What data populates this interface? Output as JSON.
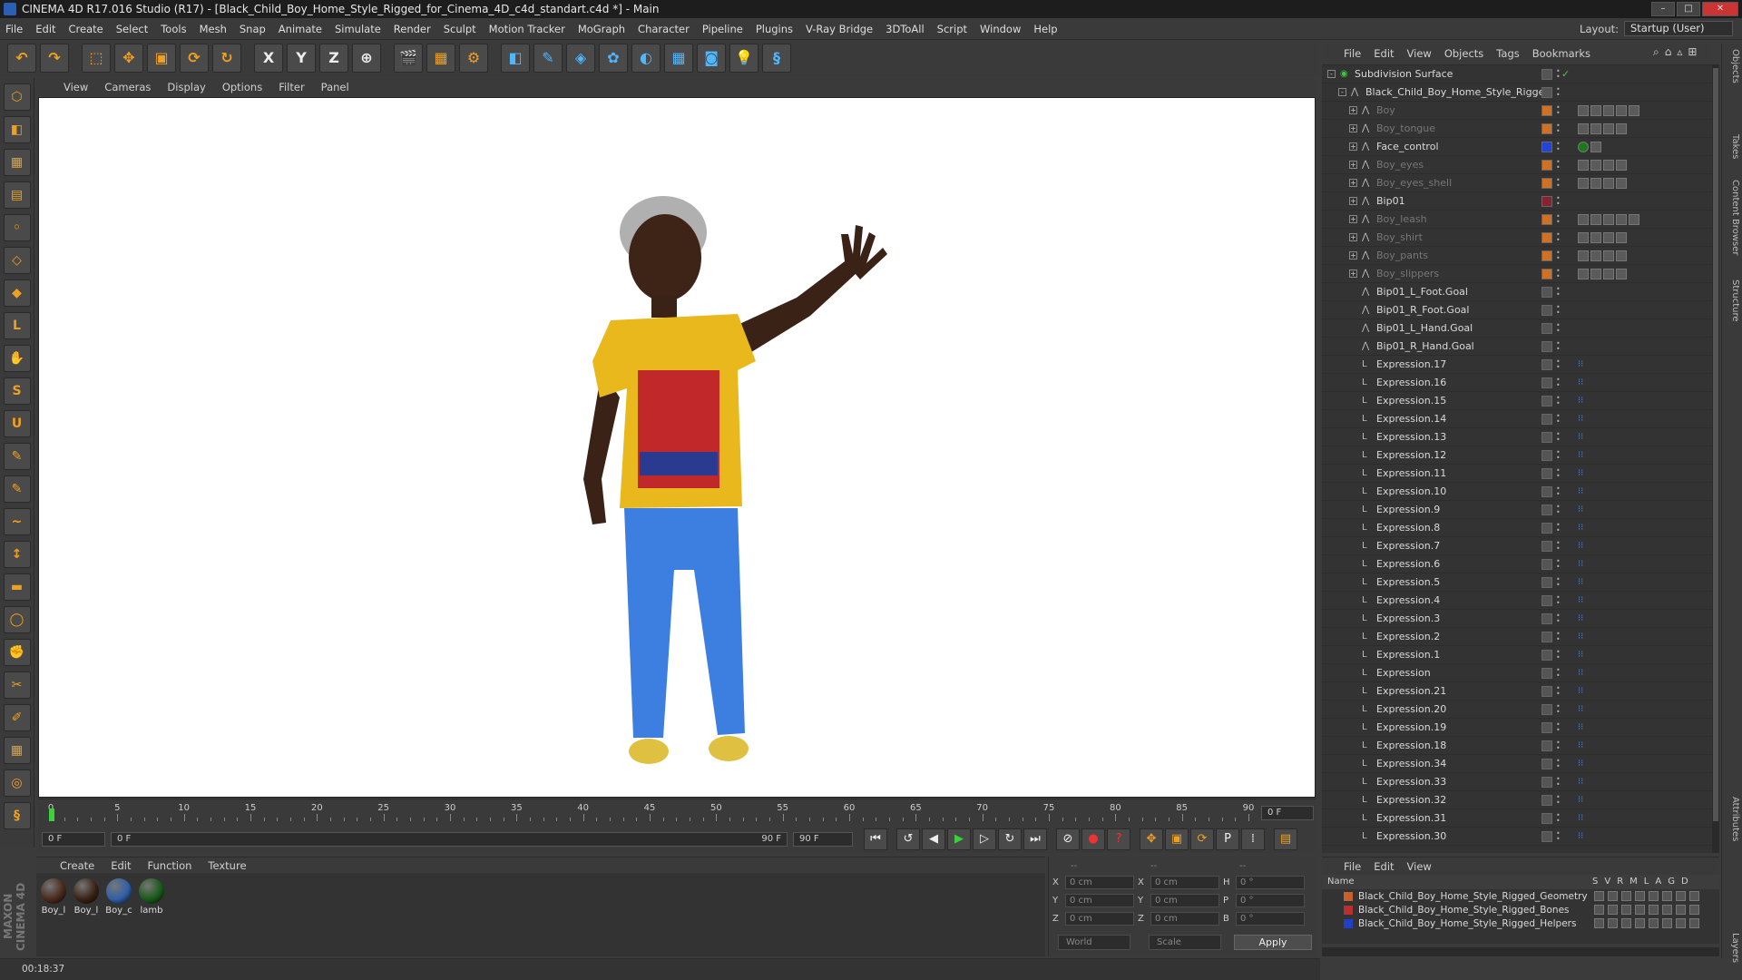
{
  "window": {
    "title": "CINEMA 4D R17.016 Studio (R17) - [Black_Child_Boy_Home_Style_Rigged_for_Cinema_4D_c4d_standart.c4d *] - Main"
  },
  "menubar": [
    "File",
    "Edit",
    "Create",
    "Select",
    "Tools",
    "Mesh",
    "Snap",
    "Animate",
    "Simulate",
    "Render",
    "Sculpt",
    "Motion Tracker",
    "MoGraph",
    "Character",
    "Pipeline",
    "Plugins",
    "V-Ray Bridge",
    "3DToAll",
    "Script",
    "Window",
    "Help"
  ],
  "layout": {
    "label": "Layout:",
    "value": "Startup (User)"
  },
  "viewport_menu": [
    "View",
    "Cameras",
    "Display",
    "Options",
    "Filter",
    "Panel"
  ],
  "timeline": {
    "ticks": [
      "0",
      "5",
      "10",
      "15",
      "20",
      "25",
      "30",
      "35",
      "40",
      "45",
      "50",
      "55",
      "60",
      "65",
      "70",
      "75",
      "80",
      "85",
      "90"
    ],
    "current_field": "0 F",
    "start_field": "0 F",
    "range_start": "0 F",
    "range_end": "90 F",
    "end_field": "90 F"
  },
  "material_menu": [
    "Create",
    "Edit",
    "Function",
    "Texture"
  ],
  "materials": [
    {
      "label": "Boy_l",
      "color": "#4a2a1c"
    },
    {
      "label": "Boy_l",
      "color": "#3a2216"
    },
    {
      "label": "Boy_c",
      "color": "#2f5fa8"
    },
    {
      "label": "lamb",
      "color": "#1a5a1a"
    }
  ],
  "coordinates": {
    "header": [
      "--",
      "--",
      "--"
    ],
    "rows": [
      {
        "a": "X",
        "av": "0 cm",
        "b": "X",
        "bv": "0 cm",
        "c": "H",
        "cv": "0 °"
      },
      {
        "a": "Y",
        "av": "0 cm",
        "b": "Y",
        "bv": "0 cm",
        "c": "P",
        "cv": "0 °"
      },
      {
        "a": "Z",
        "av": "0 cm",
        "b": "Z",
        "bv": "0 cm",
        "c": "B",
        "cv": "0 °"
      }
    ],
    "space": "World",
    "mode": "Scale",
    "apply": "Apply"
  },
  "status": "00:18:37",
  "object_menu": [
    "File",
    "Edit",
    "View",
    "Objects",
    "Tags",
    "Bookmarks"
  ],
  "objects": [
    {
      "name": "Subdivision Surface",
      "indent": 0,
      "expand": "-",
      "dim": false,
      "color": "#555",
      "tags": 0,
      "check": true
    },
    {
      "name": "Black_Child_Boy_Home_Style_Rigged",
      "indent": 1,
      "expand": "-",
      "dim": false,
      "color": "#555",
      "tags": 0
    },
    {
      "name": "Boy",
      "indent": 2,
      "expand": "+",
      "dim": true,
      "color": "#d07020",
      "tags": 5
    },
    {
      "name": "Boy_tongue",
      "indent": 2,
      "expand": "+",
      "dim": true,
      "color": "#d07020",
      "tags": 4
    },
    {
      "name": "Face_control",
      "indent": 2,
      "expand": "+",
      "dim": false,
      "color": "#2244dd",
      "tags": 2
    },
    {
      "name": "Boy_eyes",
      "indent": 2,
      "expand": "+",
      "dim": true,
      "color": "#d07020",
      "tags": 4
    },
    {
      "name": "Boy_eyes_shell",
      "indent": 2,
      "expand": "+",
      "dim": true,
      "color": "#d07020",
      "tags": 4
    },
    {
      "name": "Bip01",
      "indent": 2,
      "expand": "+",
      "dim": false,
      "color": "#882233",
      "tags": 0
    },
    {
      "name": "Boy_leash",
      "indent": 2,
      "expand": "+",
      "dim": true,
      "color": "#d07020",
      "tags": 5
    },
    {
      "name": "Boy_shirt",
      "indent": 2,
      "expand": "+",
      "dim": true,
      "color": "#d07020",
      "tags": 4
    },
    {
      "name": "Boy_pants",
      "indent": 2,
      "expand": "+",
      "dim": true,
      "color": "#d07020",
      "tags": 4
    },
    {
      "name": "Boy_slippers",
      "indent": 2,
      "expand": "+",
      "dim": true,
      "color": "#d07020",
      "tags": 4
    },
    {
      "name": "Bip01_L_Foot.Goal",
      "indent": 2,
      "expand": "",
      "dim": false,
      "color": "#555",
      "tags": 0
    },
    {
      "name": "Bip01_R_Foot.Goal",
      "indent": 2,
      "expand": "",
      "dim": false,
      "color": "#555",
      "tags": 0
    },
    {
      "name": "Bip01_L_Hand.Goal",
      "indent": 2,
      "expand": "",
      "dim": false,
      "color": "#555",
      "tags": 0
    },
    {
      "name": "Bip01_R_Hand.Goal",
      "indent": 2,
      "expand": "",
      "dim": false,
      "color": "#555",
      "tags": 0
    },
    {
      "name": "Expression.17",
      "indent": 2,
      "expr": true
    },
    {
      "name": "Expression.16",
      "indent": 2,
      "expr": true
    },
    {
      "name": "Expression.15",
      "indent": 2,
      "expr": true
    },
    {
      "name": "Expression.14",
      "indent": 2,
      "expr": true
    },
    {
      "name": "Expression.13",
      "indent": 2,
      "expr": true
    },
    {
      "name": "Expression.12",
      "indent": 2,
      "expr": true
    },
    {
      "name": "Expression.11",
      "indent": 2,
      "expr": true
    },
    {
      "name": "Expression.10",
      "indent": 2,
      "expr": true
    },
    {
      "name": "Expression.9",
      "indent": 2,
      "expr": true
    },
    {
      "name": "Expression.8",
      "indent": 2,
      "expr": true
    },
    {
      "name": "Expression.7",
      "indent": 2,
      "expr": true
    },
    {
      "name": "Expression.6",
      "indent": 2,
      "expr": true
    },
    {
      "name": "Expression.5",
      "indent": 2,
      "expr": true
    },
    {
      "name": "Expression.4",
      "indent": 2,
      "expr": true
    },
    {
      "name": "Expression.3",
      "indent": 2,
      "expr": true
    },
    {
      "name": "Expression.2",
      "indent": 2,
      "expr": true
    },
    {
      "name": "Expression.1",
      "indent": 2,
      "expr": true
    },
    {
      "name": "Expression",
      "indent": 2,
      "expr": true
    },
    {
      "name": "Expression.21",
      "indent": 2,
      "expr": true
    },
    {
      "name": "Expression.20",
      "indent": 2,
      "expr": true
    },
    {
      "name": "Expression.19",
      "indent": 2,
      "expr": true
    },
    {
      "name": "Expression.18",
      "indent": 2,
      "expr": true
    },
    {
      "name": "Expression.34",
      "indent": 2,
      "expr": true
    },
    {
      "name": "Expression.33",
      "indent": 2,
      "expr": true
    },
    {
      "name": "Expression.32",
      "indent": 2,
      "expr": true
    },
    {
      "name": "Expression.31",
      "indent": 2,
      "expr": true
    },
    {
      "name": "Expression.30",
      "indent": 2,
      "expr": true
    }
  ],
  "right_tabs": [
    "Objects",
    "Takes",
    "Content Browser",
    "Structure",
    "Attributes",
    "Layers"
  ],
  "layer_menu": [
    "File",
    "Edit",
    "View"
  ],
  "layer_header": {
    "name": "Name",
    "flags": [
      "S",
      "V",
      "R",
      "M",
      "L",
      "A",
      "G",
      "D"
    ]
  },
  "layers": [
    {
      "name": "Black_Child_Boy_Home_Style_Rigged_Geometry",
      "color": "#c8602a"
    },
    {
      "name": "Black_Child_Boy_Home_Style_Rigged_Bones",
      "color": "#b83030"
    },
    {
      "name": "Black_Child_Boy_Home_Style_Rigged_Helpers",
      "color": "#2040c8"
    }
  ],
  "toolbar_icons": [
    "undo-icon",
    "redo-icon",
    "live-select-icon",
    "move-icon",
    "scale-icon",
    "rotate-icon",
    "recent-tool-icon",
    "x-axis-icon",
    "y-axis-icon",
    "z-axis-icon",
    "coordinate-system-icon",
    "render-view-icon",
    "render-picture-viewer-icon",
    "edit-render-settings-icon",
    "cube-icon",
    "pen-spline-icon",
    "subdivision-icon",
    "array-icon",
    "deformer-icon",
    "floor-icon",
    "camera-icon",
    "light-icon",
    "python-icon"
  ],
  "left_icons": [
    "make-editable-icon",
    "model-mode-icon",
    "texture-mode-icon",
    "workplane-icon",
    "points-mode-icon",
    "edges-mode-icon",
    "polygons-mode-icon",
    "axis-mode-icon",
    "tweak-mode-icon",
    "snap-icon",
    "magnet-icon",
    "sculpt-icon",
    "brush-icon",
    "smooth-icon",
    "pull-icon",
    "flatten-icon",
    "inflate-icon",
    "grab-icon",
    "knife-icon",
    "paint-icon",
    "layer-lock-icon",
    "solo-icon",
    "python-left-icon"
  ]
}
